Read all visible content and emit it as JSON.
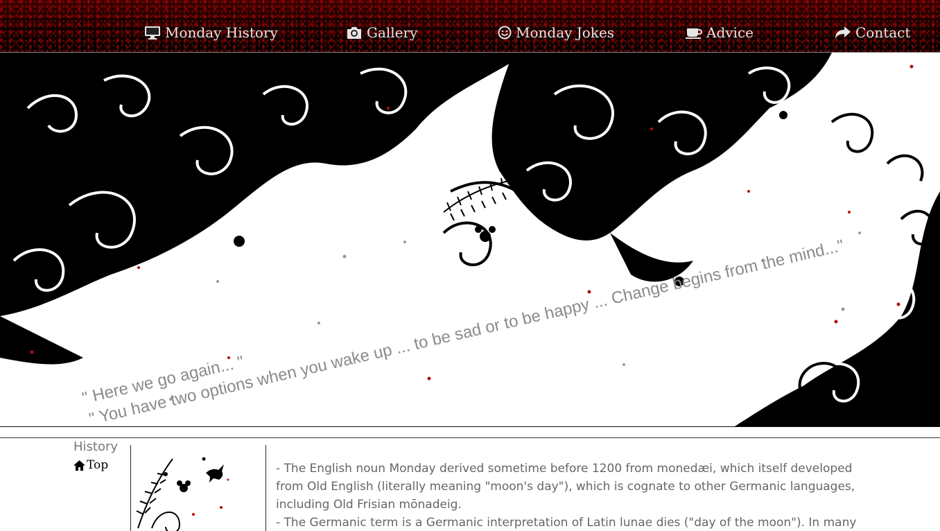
{
  "nav": {
    "items": [
      {
        "label": "Monday History",
        "icon": "desktop-icon"
      },
      {
        "label": "Gallery",
        "icon": "camera-icon"
      },
      {
        "label": "Monday Jokes",
        "icon": "smiley-icon"
      },
      {
        "label": "Advice",
        "icon": "coffee-cup-icon"
      },
      {
        "label": "Contact",
        "icon": "share-arrow-icon"
      }
    ]
  },
  "banner": {
    "quote_1": "\" Here we go again... \"",
    "quote_2": "\" You have two options when you wake up ... to be sad or to be happy ... Change begins from the mind...\""
  },
  "section": {
    "label": "History",
    "top_link": "Top"
  },
  "content": {
    "paragraphs": [
      "- The English noun Monday derived sometime before 1200 from monedæi, which itself developed from Old English (literally meaning \"moon's day\"), which is cognate to other Germanic languages, including Old Frisian mōnadeig.",
      "- The Germanic term is a Germanic interpretation of Latin lunae dies (\"day of the moon\"). In many"
    ]
  },
  "colors": {
    "nav_bg": "#1a0000",
    "nav_accent": "#b00000",
    "quote_text": "#8a8a8a",
    "body_text": "#666666"
  }
}
